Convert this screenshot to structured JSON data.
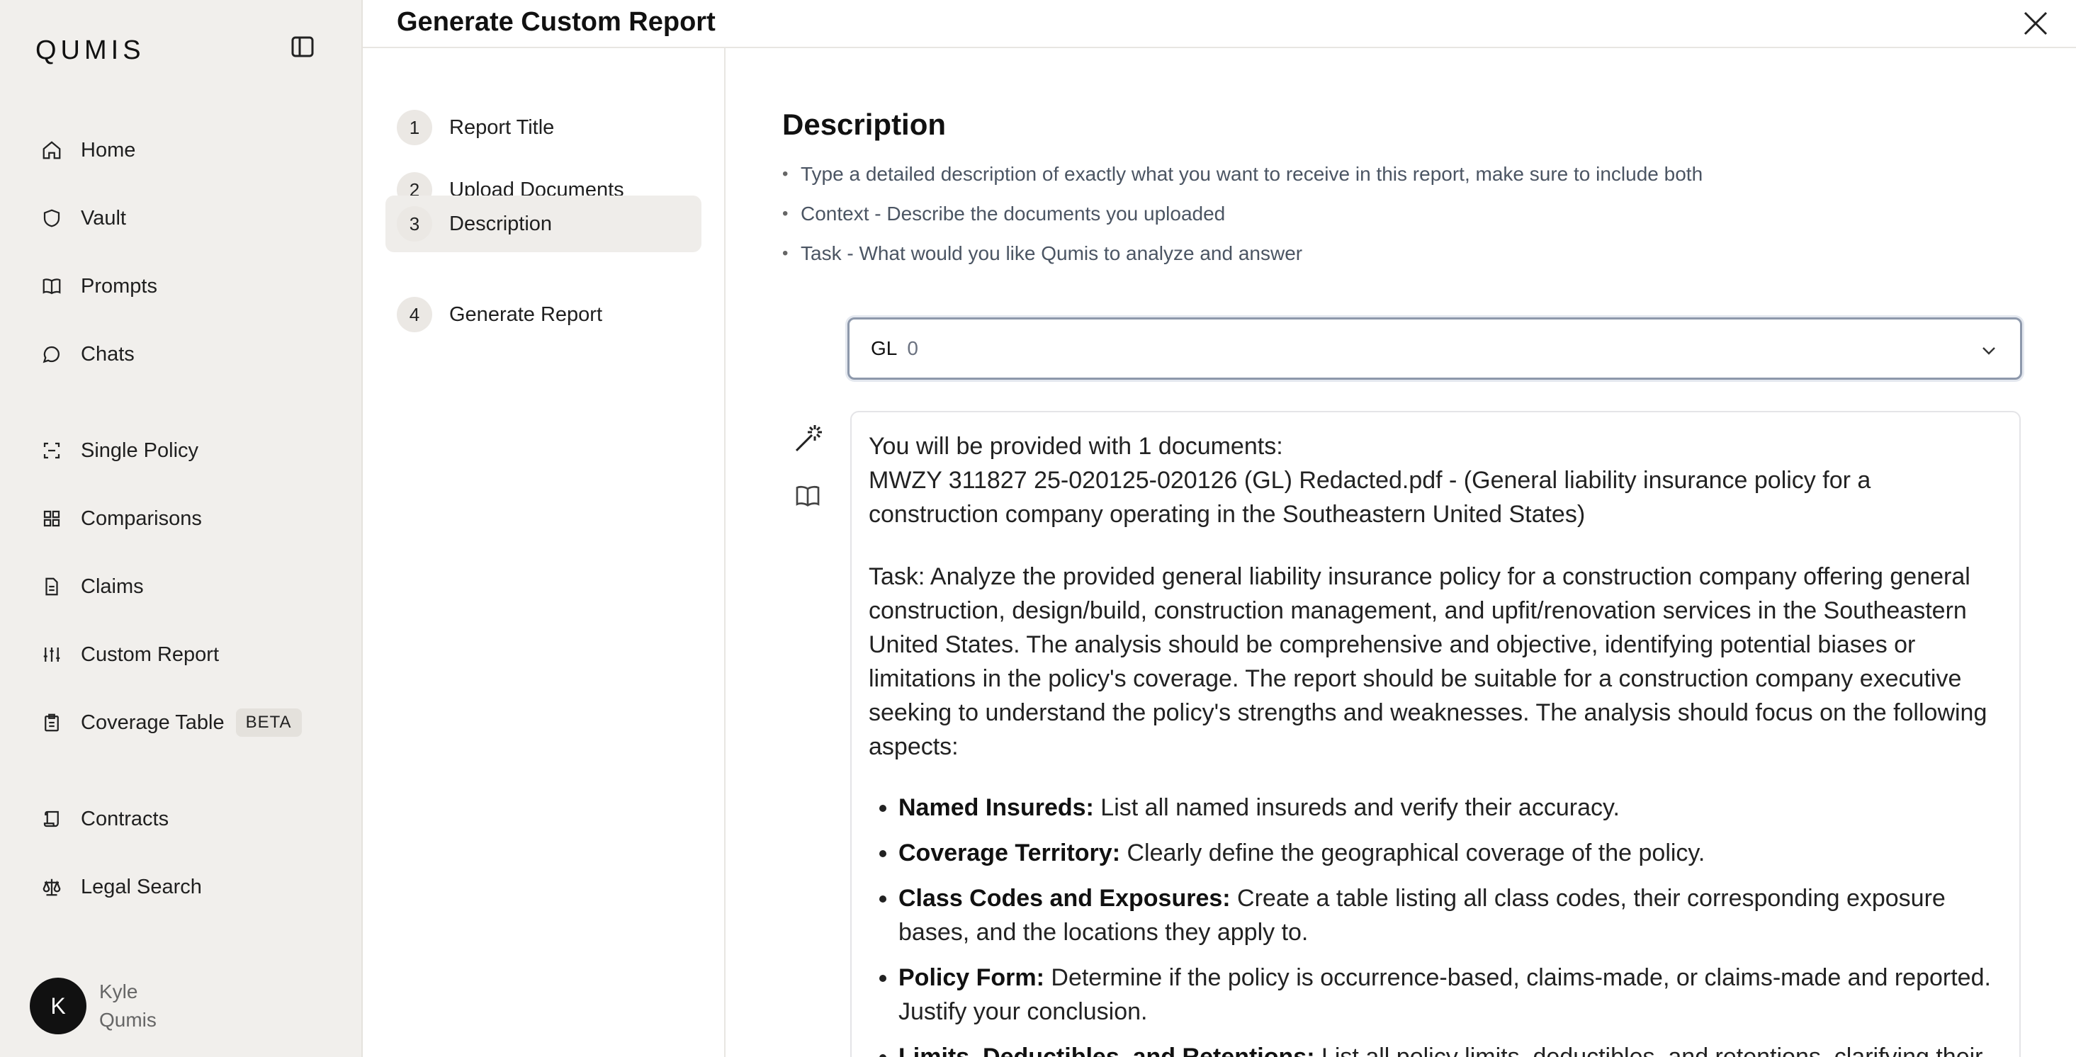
{
  "sidebar": {
    "logo": "QUMIS",
    "nav": [
      {
        "label": "Home",
        "icon": "home-icon"
      },
      {
        "label": "Vault",
        "icon": "shield-icon"
      },
      {
        "label": "Prompts",
        "icon": "book-icon"
      },
      {
        "label": "Chats",
        "icon": "chat-icon"
      },
      {
        "label": "Single Policy",
        "icon": "scan-icon"
      },
      {
        "label": "Comparisons",
        "icon": "grid-icon"
      },
      {
        "label": "Claims",
        "icon": "document-icon"
      },
      {
        "label": "Custom Report",
        "icon": "sliders-icon"
      },
      {
        "label": "Coverage Table",
        "icon": "clipboard-icon",
        "badge": "BETA"
      },
      {
        "label": "Contracts",
        "icon": "scroll-icon"
      },
      {
        "label": "Legal Search",
        "icon": "scale-icon"
      }
    ],
    "user": {
      "initial": "K",
      "first": "Kyle",
      "last": "Qumis"
    }
  },
  "header": {
    "title": "Generate Custom Report"
  },
  "steps": [
    {
      "num": "1",
      "label": "Report Title"
    },
    {
      "num": "2",
      "label": "Upload Documents"
    },
    {
      "num": "3",
      "label": "Description",
      "active": true
    },
    {
      "num": "4",
      "label": "Generate Report"
    }
  ],
  "main": {
    "heading": "Description",
    "bullets": [
      "Type a detailed description of exactly what you want to receive in this report, make sure to include both",
      "Context - Describe the documents you uploaded",
      "Task - What would you like Qumis to analyze and answer"
    ],
    "select": {
      "value": "GL",
      "count": "0"
    },
    "editor": {
      "intro_line1": "You will be provided with 1 documents:",
      "intro_line2": "MWZY 311827 25-020125-020126 (GL) Redacted.pdf - (General liability insurance policy for a construction company operating in the Southeastern United States)",
      "task": "Task: Analyze the provided general liability insurance policy for a construction company offering general construction, design/build, construction management, and upfit/renovation services in the Southeastern United States. The analysis should be comprehensive and objective, identifying potential biases or limitations in the policy's coverage. The report should be suitable for a construction company executive seeking to understand the policy's strengths and weaknesses. The analysis should focus on the following aspects:",
      "items": [
        {
          "label": "Named Insureds:",
          "text": " List all named insureds and verify their accuracy."
        },
        {
          "label": "Coverage Territory:",
          "text": " Clearly define the geographical coverage of the policy."
        },
        {
          "label": "Class Codes and Exposures:",
          "text": " Create a table listing all class codes, their corresponding exposure bases, and the locations they apply to."
        },
        {
          "label": "Policy Form:",
          "text": " Determine if the policy is occurrence-based, claims-made, or claims-made and reported. Justify your conclusion."
        },
        {
          "label": "Limits, Deductibles, and Retentions:",
          "text": "  List all policy limits, deductibles, and retentions, clarifying their applicability and any potential limitations."
        }
      ]
    }
  }
}
